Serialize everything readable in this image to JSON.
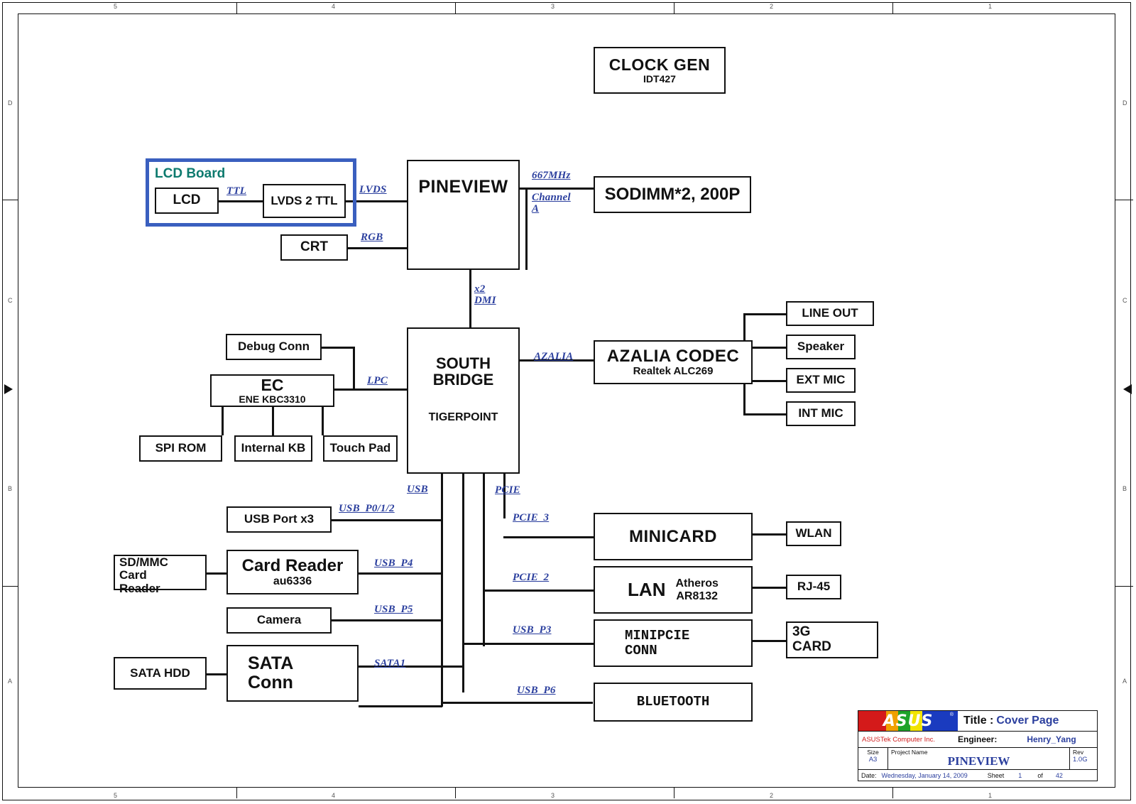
{
  "sheet": {
    "top_ruler": [
      "5",
      "4",
      "3",
      "2",
      "1"
    ],
    "bottom_ruler": [
      "5",
      "4",
      "3",
      "2",
      "1"
    ],
    "left_zones": [
      "D",
      "C",
      "B",
      "A"
    ],
    "right_zones": [
      "D",
      "C",
      "B",
      "A"
    ]
  },
  "blocks": {
    "clock_gen": {
      "t1": "CLOCK GEN",
      "t2": "IDT427"
    },
    "lcd_board": {
      "label": "LCD Board"
    },
    "lcd": {
      "t1": "LCD"
    },
    "lvds2ttl": {
      "t1": "LVDS 2 TTL"
    },
    "crt": {
      "t1": "CRT"
    },
    "pineview": {
      "t1": "PINEVIEW"
    },
    "sodimm": {
      "t1": "SODIMM*2, 200P"
    },
    "south_bridge": {
      "t1": "SOUTH",
      "t2": "BRIDGE",
      "t3": "TIGERPOINT"
    },
    "debug_conn": {
      "t1": "Debug Conn"
    },
    "ec": {
      "t1": "EC",
      "t2": "ENE KBC3310"
    },
    "spi_rom": {
      "t1": "SPI ROM"
    },
    "internal_kb": {
      "t1": "Internal KB"
    },
    "touch_pad": {
      "t1": "Touch Pad"
    },
    "azalia_codec": {
      "t1": "AZALIA CODEC",
      "t2": "Realtek ALC269"
    },
    "line_out": {
      "t1": "LINE OUT"
    },
    "speaker": {
      "t1": "Speaker"
    },
    "ext_mic": {
      "t1": "EXT MIC"
    },
    "int_mic": {
      "t1": "INT MIC"
    },
    "usb_port_x3": {
      "t1": "USB Port x3"
    },
    "sd_mmc": {
      "t1": "SD/MMC",
      "t2": "Card",
      "t3": "Reader"
    },
    "card_reader": {
      "t1": "Card Reader",
      "t2": "au6336"
    },
    "camera": {
      "t1": "Camera"
    },
    "sata_hdd": {
      "t1": "SATA HDD"
    },
    "sata_conn": {
      "t1": "SATA",
      "t2": "Conn"
    },
    "minicard": {
      "t1": "MINICARD"
    },
    "wlan": {
      "t1": "WLAN"
    },
    "lan": {
      "t1": "LAN",
      "t2": "Atheros",
      "t3": "AR8132"
    },
    "rj45": {
      "t1": "RJ-45"
    },
    "minipcie": {
      "t1": "MINIPCIE",
      "t2": "CONN"
    },
    "card_3g": {
      "t1": "3G",
      "t2": "CARD"
    },
    "bluetooth": {
      "t1": "BLUETOOTH"
    }
  },
  "signals": {
    "ttl": "TTL",
    "lvds": "LVDS",
    "rgb": "RGB",
    "mhz667": "667MHz",
    "channel_a": "Channel\nA",
    "x2_dmi": "x2\nDMI",
    "lpc": "LPC",
    "azalia": "AZALIA",
    "usb": "USB",
    "usb_p012": "USB_P0/1/2",
    "usb_p4": "USB_P4",
    "usb_p5": "USB_P5",
    "sata1": "SATA1",
    "pcie": "PCIE",
    "pcie_3": "PCIE_3",
    "pcie_2": "PCIE_2",
    "usb_p3": "USB_P3",
    "usb_p6": "USB_P6"
  },
  "title_block": {
    "logo_text": "ASUS",
    "logo_reg": "®",
    "company": "ASUSTek Computer Inc.",
    "title_label": "Title :",
    "title_value": "Cover Page",
    "engineer_label": "Engineer:",
    "engineer_value": "Henry_Yang",
    "size_caption": "Size",
    "size_value": "A3",
    "project_caption": "Project Name",
    "project_value": "PINEVIEW",
    "rev_caption": "Rev",
    "rev_value": "1.0G",
    "date_caption": "Date:",
    "date_value": "Wednesday, January 14, 2009",
    "sheet_caption": "Sheet",
    "sheet_number": "1",
    "sheet_of": "of",
    "sheet_total": "42"
  },
  "colors": {
    "signal_blue": "#2b3f9e",
    "lcd_board_border": "#3a5fbf",
    "lcd_board_label": "#0d7a6e",
    "company_red": "#d01b1b",
    "line_black": "#111111"
  }
}
